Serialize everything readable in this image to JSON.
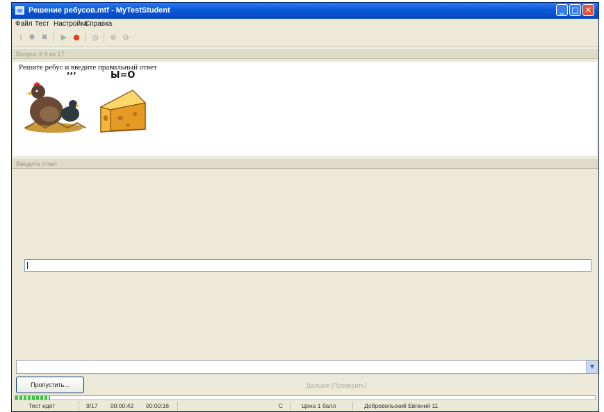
{
  "window": {
    "title": "Решение ребусов.mtf - MyTestStudent"
  },
  "window_controls": {
    "minimize": "_",
    "maximize": "□",
    "close": "✕"
  },
  "menu": [
    "Файл",
    "Тест",
    "Настройка",
    "Справка"
  ],
  "toolbar": {
    "icons": [
      "info-icon",
      "lightbulb-icon",
      "cancel-icon",
      "play-icon",
      "stop-icon",
      "chat-icon",
      "zoom-in-icon",
      "zoom-out-icon"
    ]
  },
  "question": {
    "header": "Вопрос # 9 из 17",
    "text": "Решите ребус и введите правильный ответ",
    "rebus_marks": "’’’",
    "rebus_equation": "Ы=О",
    "images": [
      "hen-image",
      "cheese-image"
    ]
  },
  "answer": {
    "header": "Введите ответ",
    "value": ""
  },
  "buttons": {
    "skip": "Пропустить...",
    "next": "Дальше (Проверить)"
  },
  "progress": {
    "fraction": 0.06
  },
  "status": {
    "state": "Тест идет",
    "position": "9/17",
    "time_total": "00:00:42",
    "time_question": "00:00:16",
    "mode": "С",
    "price": "Цена 1 балл",
    "student": "Добровольский Евгений 11"
  },
  "colors": {
    "titlebar": "#0a58d8",
    "window_bg": "#ece9d8",
    "progress": "#3ac43a",
    "close_button": "#e0563a"
  }
}
